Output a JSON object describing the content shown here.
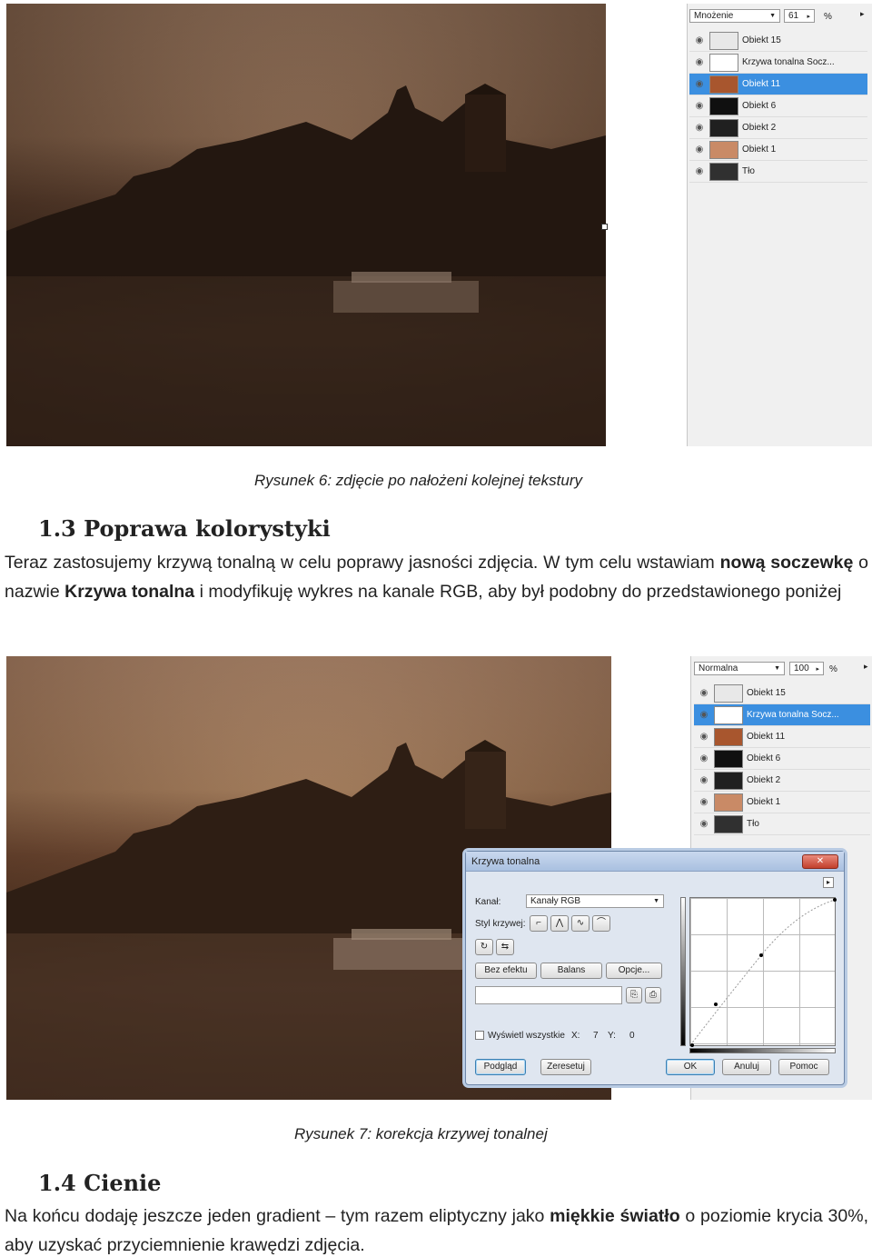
{
  "figure6": {
    "layers_panel": {
      "blend_mode": "Mnożenie",
      "opacity": "61",
      "percent": "%",
      "layers": [
        {
          "name": "Obiekt 15",
          "thumb": "#e8e8e8",
          "selected": false
        },
        {
          "name": "Krzywa tonalna Socz...",
          "thumb": "#ffffff",
          "selected": false
        },
        {
          "name": "Obiekt 11",
          "thumb": "#a8562e",
          "selected": true
        },
        {
          "name": "Obiekt 6",
          "thumb": "#101010",
          "selected": false
        },
        {
          "name": "Obiekt 2",
          "thumb": "#202020",
          "selected": false
        },
        {
          "name": "Obiekt 1",
          "thumb": "#c98a66",
          "selected": false
        },
        {
          "name": "Tło",
          "thumb": "#303030",
          "selected": false
        }
      ]
    },
    "caption": "Rysunek 6: zdjęcie po nałożeni kolejnej tekstury"
  },
  "section13": {
    "heading": "1.3 Poprawa kolorystyki",
    "p_part1": "Teraz zastosujemy krzywą tonalną w celu poprawy jasności zdjęcia. W tym celu wstawiam ",
    "bold1": "nową soczewkę",
    "p_part2": " o nazwie ",
    "bold2": "Krzywa tonalna",
    "p_part3": " i modyfikuję wykres na kanale RGB, aby był podobny do przedstawionego poniżej"
  },
  "figure7": {
    "layers_panel": {
      "blend_mode": "Normalna",
      "opacity": "100",
      "percent": "%",
      "layers": [
        {
          "name": "Obiekt 15",
          "thumb": "#e8e8e8",
          "selected": false
        },
        {
          "name": "Krzywa tonalna Socz...",
          "thumb": "#ffffff",
          "selected": true
        },
        {
          "name": "Obiekt 11",
          "thumb": "#a8562e",
          "selected": false
        },
        {
          "name": "Obiekt 6",
          "thumb": "#101010",
          "selected": false
        },
        {
          "name": "Obiekt 2",
          "thumb": "#202020",
          "selected": false
        },
        {
          "name": "Obiekt 1",
          "thumb": "#c98a66",
          "selected": false
        },
        {
          "name": "Tło",
          "thumb": "#303030",
          "selected": false
        }
      ]
    },
    "dialog": {
      "title": "Krzywa tonalna",
      "close": "✕",
      "channel_label": "Kanał:",
      "channel_value": "Kanały RGB",
      "style_label": "Styl krzywej:",
      "btn_no_effect": "Bez efektu",
      "btn_balance": "Balans",
      "btn_options": "Opcje...",
      "show_all": "Wyświetl wszystkie",
      "x_label": "X:",
      "x_value": "7",
      "y_label": "Y:",
      "y_value": "0",
      "btn_preview": "Podgląd",
      "btn_reset": "Zeresetuj",
      "btn_ok": "OK",
      "btn_cancel": "Anuluj",
      "btn_help": "Pomoc"
    },
    "caption": "Rysunek 7: korekcja krzywej tonalnej"
  },
  "section14": {
    "heading": "1.4 Cienie",
    "p_part1": "Na końcu dodaję jeszcze jeden gradient – tym razem eliptyczny jako ",
    "bold1": "miękkie światło",
    "p_part2": " o poziomie krycia 30%, aby uzyskać przyciemnienie krawędzi zdjęcia."
  }
}
